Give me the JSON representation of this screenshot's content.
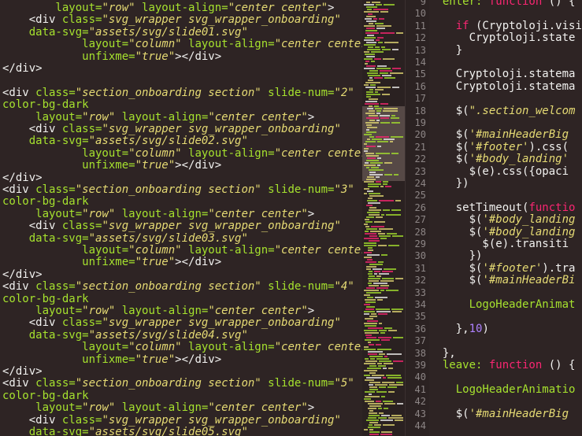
{
  "left_code": {
    "lines": [
      [
        {
          "t": "        layout=",
          "c": "attr"
        },
        {
          "t": "\"row\"",
          "c": "str"
        },
        {
          "t": " layout-align=",
          "c": "attr"
        },
        {
          "t": "\"center center\"",
          "c": "str"
        },
        {
          "t": ">",
          "c": "tag"
        }
      ],
      [
        {
          "t": "    <div ",
          "c": "tag"
        },
        {
          "t": "class=",
          "c": "attr"
        },
        {
          "t": "\"svg_wrapper svg_wrapper_onboarding\"",
          "c": "str"
        }
      ],
      [
        {
          "t": "    data-svg=",
          "c": "attr"
        },
        {
          "t": "\"assets/svg/slide01.svg\"",
          "c": "str"
        }
      ],
      [
        {
          "t": "            layout=",
          "c": "attr"
        },
        {
          "t": "\"column\"",
          "c": "str"
        },
        {
          "t": " layout-align=",
          "c": "attr"
        },
        {
          "t": "\"center center\"",
          "c": "str"
        }
      ],
      [
        {
          "t": "            unfixme=",
          "c": "attr"
        },
        {
          "t": "\"true\"",
          "c": "str"
        },
        {
          "t": "></div>",
          "c": "tag"
        }
      ],
      [
        {
          "t": "</div>",
          "c": "tag"
        }
      ],
      [
        {
          "t": "",
          "c": "t"
        }
      ],
      [
        {
          "t": "<div ",
          "c": "tag"
        },
        {
          "t": "class=",
          "c": "attr"
        },
        {
          "t": "\"section_onboarding section\"",
          "c": "str"
        },
        {
          "t": " slide-num=",
          "c": "attr"
        },
        {
          "t": "\"2\"",
          "c": "str"
        }
      ],
      [
        {
          "t": "color-bg-dark",
          "c": "attr"
        }
      ],
      [
        {
          "t": "     layout=",
          "c": "attr"
        },
        {
          "t": "\"row\"",
          "c": "str"
        },
        {
          "t": " layout-align=",
          "c": "attr"
        },
        {
          "t": "\"center center\"",
          "c": "str"
        },
        {
          "t": ">",
          "c": "tag"
        }
      ],
      [
        {
          "t": "    <div ",
          "c": "tag"
        },
        {
          "t": "class=",
          "c": "attr"
        },
        {
          "t": "\"svg_wrapper svg_wrapper_onboarding\"",
          "c": "str"
        }
      ],
      [
        {
          "t": "    data-svg=",
          "c": "attr"
        },
        {
          "t": "\"assets/svg/slide02.svg\"",
          "c": "str"
        }
      ],
      [
        {
          "t": "            layout=",
          "c": "attr"
        },
        {
          "t": "\"column\"",
          "c": "str"
        },
        {
          "t": " layout-align=",
          "c": "attr"
        },
        {
          "t": "\"center center\"",
          "c": "str"
        }
      ],
      [
        {
          "t": "            unfixme=",
          "c": "attr"
        },
        {
          "t": "\"true\"",
          "c": "str"
        },
        {
          "t": "></div>",
          "c": "tag"
        }
      ],
      [
        {
          "t": "</div>",
          "c": "tag"
        }
      ],
      [
        {
          "t": "<div ",
          "c": "tag"
        },
        {
          "t": "class=",
          "c": "attr"
        },
        {
          "t": "\"section_onboarding section\"",
          "c": "str"
        },
        {
          "t": " slide-num=",
          "c": "attr"
        },
        {
          "t": "\"3\"",
          "c": "str"
        }
      ],
      [
        {
          "t": "color-bg-dark",
          "c": "attr"
        }
      ],
      [
        {
          "t": "     layout=",
          "c": "attr"
        },
        {
          "t": "\"row\"",
          "c": "str"
        },
        {
          "t": " layout-align=",
          "c": "attr"
        },
        {
          "t": "\"center center\"",
          "c": "str"
        },
        {
          "t": ">",
          "c": "tag"
        }
      ],
      [
        {
          "t": "    <div ",
          "c": "tag"
        },
        {
          "t": "class=",
          "c": "attr"
        },
        {
          "t": "\"svg_wrapper svg_wrapper_onboarding\"",
          "c": "str"
        }
      ],
      [
        {
          "t": "    data-svg=",
          "c": "attr"
        },
        {
          "t": "\"assets/svg/slide03.svg\"",
          "c": "str"
        }
      ],
      [
        {
          "t": "            layout=",
          "c": "attr"
        },
        {
          "t": "\"column\"",
          "c": "str"
        },
        {
          "t": " layout-align=",
          "c": "attr"
        },
        {
          "t": "\"center center\"",
          "c": "str"
        }
      ],
      [
        {
          "t": "            unfixme=",
          "c": "attr"
        },
        {
          "t": "\"true\"",
          "c": "str"
        },
        {
          "t": "></div>",
          "c": "tag"
        }
      ],
      [
        {
          "t": "</div>",
          "c": "tag"
        }
      ],
      [
        {
          "t": "<div ",
          "c": "tag"
        },
        {
          "t": "class=",
          "c": "attr"
        },
        {
          "t": "\"section_onboarding section\"",
          "c": "str"
        },
        {
          "t": " slide-num=",
          "c": "attr"
        },
        {
          "t": "\"4\"",
          "c": "str"
        }
      ],
      [
        {
          "t": "color-bg-dark",
          "c": "attr"
        }
      ],
      [
        {
          "t": "     layout=",
          "c": "attr"
        },
        {
          "t": "\"row\"",
          "c": "str"
        },
        {
          "t": " layout-align=",
          "c": "attr"
        },
        {
          "t": "\"center center\"",
          "c": "str"
        },
        {
          "t": ">",
          "c": "tag"
        }
      ],
      [
        {
          "t": "    <div ",
          "c": "tag"
        },
        {
          "t": "class=",
          "c": "attr"
        },
        {
          "t": "\"svg_wrapper svg_wrapper_onboarding\"",
          "c": "str"
        }
      ],
      [
        {
          "t": "    data-svg=",
          "c": "attr"
        },
        {
          "t": "\"assets/svg/slide04.svg\"",
          "c": "str"
        }
      ],
      [
        {
          "t": "            layout=",
          "c": "attr"
        },
        {
          "t": "\"column\"",
          "c": "str"
        },
        {
          "t": " layout-align=",
          "c": "attr"
        },
        {
          "t": "\"center center\"",
          "c": "str"
        }
      ],
      [
        {
          "t": "            unfixme=",
          "c": "attr"
        },
        {
          "t": "\"true\"",
          "c": "str"
        },
        {
          "t": "></div>",
          "c": "tag"
        }
      ],
      [
        {
          "t": "</div>",
          "c": "tag"
        }
      ],
      [
        {
          "t": "<div ",
          "c": "tag"
        },
        {
          "t": "class=",
          "c": "attr"
        },
        {
          "t": "\"section_onboarding section\"",
          "c": "str"
        },
        {
          "t": " slide-num=",
          "c": "attr"
        },
        {
          "t": "\"5\"",
          "c": "str"
        }
      ],
      [
        {
          "t": "color-bg-dark",
          "c": "attr"
        }
      ],
      [
        {
          "t": "     layout=",
          "c": "attr"
        },
        {
          "t": "\"row\"",
          "c": "str"
        },
        {
          "t": " layout-align=",
          "c": "attr"
        },
        {
          "t": "\"center center\"",
          "c": "str"
        },
        {
          "t": ">",
          "c": "tag"
        }
      ],
      [
        {
          "t": "    <div ",
          "c": "tag"
        },
        {
          "t": "class=",
          "c": "attr"
        },
        {
          "t": "\"svg_wrapper svg_wrapper_onboarding\"",
          "c": "str"
        }
      ],
      [
        {
          "t": "    data-svg=",
          "c": "attr"
        },
        {
          "t": "\"assets/svg/slide05.svg\"",
          "c": "str"
        }
      ]
    ]
  },
  "right_code": {
    "line_numbers": [
      "9",
      "10",
      "11",
      "12",
      "13",
      "14",
      "15",
      "16",
      "17",
      "18",
      "19",
      "20",
      "21",
      "22",
      "23",
      "24",
      "25",
      "26",
      "27",
      "28",
      "29",
      "30",
      "31",
      "32",
      "33",
      "34",
      "35",
      "36",
      "37",
      "38",
      "39",
      "40",
      "41",
      "42",
      "43",
      "44"
    ],
    "lines": [
      [
        {
          "t": "  enter: ",
          "c": "attr"
        },
        {
          "t": "function",
          "c": "kw"
        },
        {
          "t": " () {",
          "c": "t"
        }
      ],
      [
        {
          "t": "",
          "c": "t"
        }
      ],
      [
        {
          "t": "    ",
          "c": "t"
        },
        {
          "t": "if",
          "c": "kw"
        },
        {
          "t": " (Cryptoloji.visi",
          "c": "t"
        }
      ],
      [
        {
          "t": "      Cryptoloji.state",
          "c": "t"
        }
      ],
      [
        {
          "t": "    }",
          "c": "t"
        }
      ],
      [
        {
          "t": "",
          "c": "t"
        }
      ],
      [
        {
          "t": "    Cryptoloji.statema",
          "c": "t"
        }
      ],
      [
        {
          "t": "    Cryptoloji.statema",
          "c": "t"
        }
      ],
      [
        {
          "t": "",
          "c": "t"
        }
      ],
      [
        {
          "t": "    $(",
          "c": "t"
        },
        {
          "t": "\".section_welcom",
          "c": "str"
        }
      ],
      [
        {
          "t": "",
          "c": "t"
        }
      ],
      [
        {
          "t": "    $(",
          "c": "t"
        },
        {
          "t": "'#mainHeaderBig",
          "c": "str"
        }
      ],
      [
        {
          "t": "    $(",
          "c": "t"
        },
        {
          "t": "'#footer'",
          "c": "str"
        },
        {
          "t": ").css(",
          "c": "t"
        }
      ],
      [
        {
          "t": "    $(",
          "c": "t"
        },
        {
          "t": "'#body_landing'",
          "c": "str"
        }
      ],
      [
        {
          "t": "      $(e).css({opaci",
          "c": "t"
        }
      ],
      [
        {
          "t": "    })",
          "c": "t"
        }
      ],
      [
        {
          "t": "",
          "c": "t"
        }
      ],
      [
        {
          "t": "    setTimeout(",
          "c": "t"
        },
        {
          "t": "functio",
          "c": "kw"
        }
      ],
      [
        {
          "t": "      $(",
          "c": "t"
        },
        {
          "t": "'#body_landing",
          "c": "str"
        }
      ],
      [
        {
          "t": "      $(",
          "c": "t"
        },
        {
          "t": "'#body_landing",
          "c": "str"
        }
      ],
      [
        {
          "t": "        $(e).transiti",
          "c": "t"
        }
      ],
      [
        {
          "t": "      })",
          "c": "t"
        }
      ],
      [
        {
          "t": "      $(",
          "c": "t"
        },
        {
          "t": "'#footer'",
          "c": "str"
        },
        {
          "t": ").tra",
          "c": "t"
        }
      ],
      [
        {
          "t": "      $(",
          "c": "t"
        },
        {
          "t": "'#mainHeaderBi",
          "c": "str"
        }
      ],
      [
        {
          "t": "",
          "c": "t"
        }
      ],
      [
        {
          "t": "      LogoHeaderAnimat",
          "c": "attr"
        }
      ],
      [
        {
          "t": "",
          "c": "t"
        }
      ],
      [
        {
          "t": "    },",
          "c": "t"
        },
        {
          "t": "10",
          "c": "num"
        },
        {
          "t": ")",
          "c": "t"
        }
      ],
      [
        {
          "t": "",
          "c": "t"
        }
      ],
      [
        {
          "t": "  },",
          "c": "t"
        }
      ],
      [
        {
          "t": "  leave: ",
          "c": "attr"
        },
        {
          "t": "function",
          "c": "kw"
        },
        {
          "t": " () {",
          "c": "t"
        }
      ],
      [
        {
          "t": "",
          "c": "t"
        }
      ],
      [
        {
          "t": "    LogoHeaderAnimatio",
          "c": "attr"
        }
      ],
      [
        {
          "t": "",
          "c": "t"
        }
      ],
      [
        {
          "t": "    $(",
          "c": "t"
        },
        {
          "t": "'#mainHeaderBig",
          "c": "str"
        }
      ],
      [
        {
          "t": "",
          "c": "t"
        }
      ]
    ]
  },
  "colors": {
    "background": "#2e2424",
    "attribute": "#a6e22e",
    "string": "#e6db74",
    "keyword": "#f92672",
    "number": "#ae81ff",
    "line_number": "#8d8686"
  }
}
